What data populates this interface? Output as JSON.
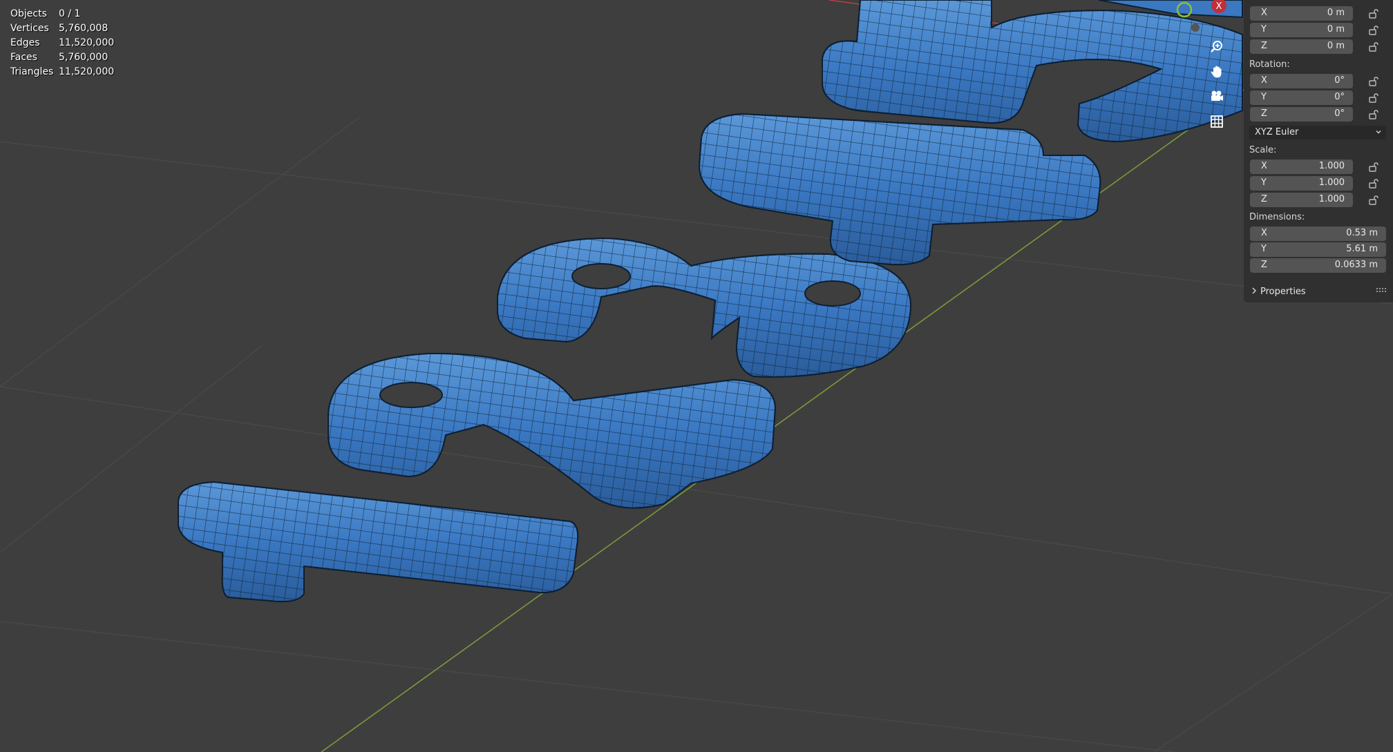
{
  "stats": {
    "objects_label": "Objects",
    "objects_value": "0 / 1",
    "vertices_label": "Vertices",
    "vertices_value": "5,760,008",
    "edges_label": "Edges",
    "edges_value": "11,520,000",
    "faces_label": "Faces",
    "faces_value": "5,760,000",
    "triangles_label": "Triangles",
    "triangles_value": "11,520,000"
  },
  "gizmo": {
    "axis_x_label": "X",
    "icons": [
      "zoom-icon",
      "pan-hand-icon",
      "camera-icon",
      "grid-icon"
    ]
  },
  "sidebar": {
    "location": {
      "x_axis": "X",
      "x": "0 m",
      "y_axis": "Y",
      "y": "0 m",
      "z_axis": "Z",
      "z": "0 m"
    },
    "rotation_label": "Rotation:",
    "rotation": {
      "x_axis": "X",
      "x": "0°",
      "y_axis": "Y",
      "y": "0°",
      "z_axis": "Z",
      "z": "0°"
    },
    "rotation_mode": "XYZ Euler",
    "scale_label": "Scale:",
    "scale": {
      "x_axis": "X",
      "x": "1.000",
      "y_axis": "Y",
      "y": "1.000",
      "z_axis": "Z",
      "z": "1.000"
    },
    "dimensions_label": "Dimensions:",
    "dimensions": {
      "x_axis": "X",
      "x": "0.53 m",
      "y_axis": "Y",
      "y": "5.61 m",
      "z_axis": "Z",
      "z": "0.0633 m"
    },
    "properties_label": "Properties"
  },
  "colors": {
    "viewport_bg": "#3e3e3e",
    "mesh_blue": "#3b78c0",
    "y_axis_line": "#7a9a3a",
    "x_axis_line": "#c04040",
    "sidebar_bg": "#303030",
    "field_bg": "#545454"
  }
}
